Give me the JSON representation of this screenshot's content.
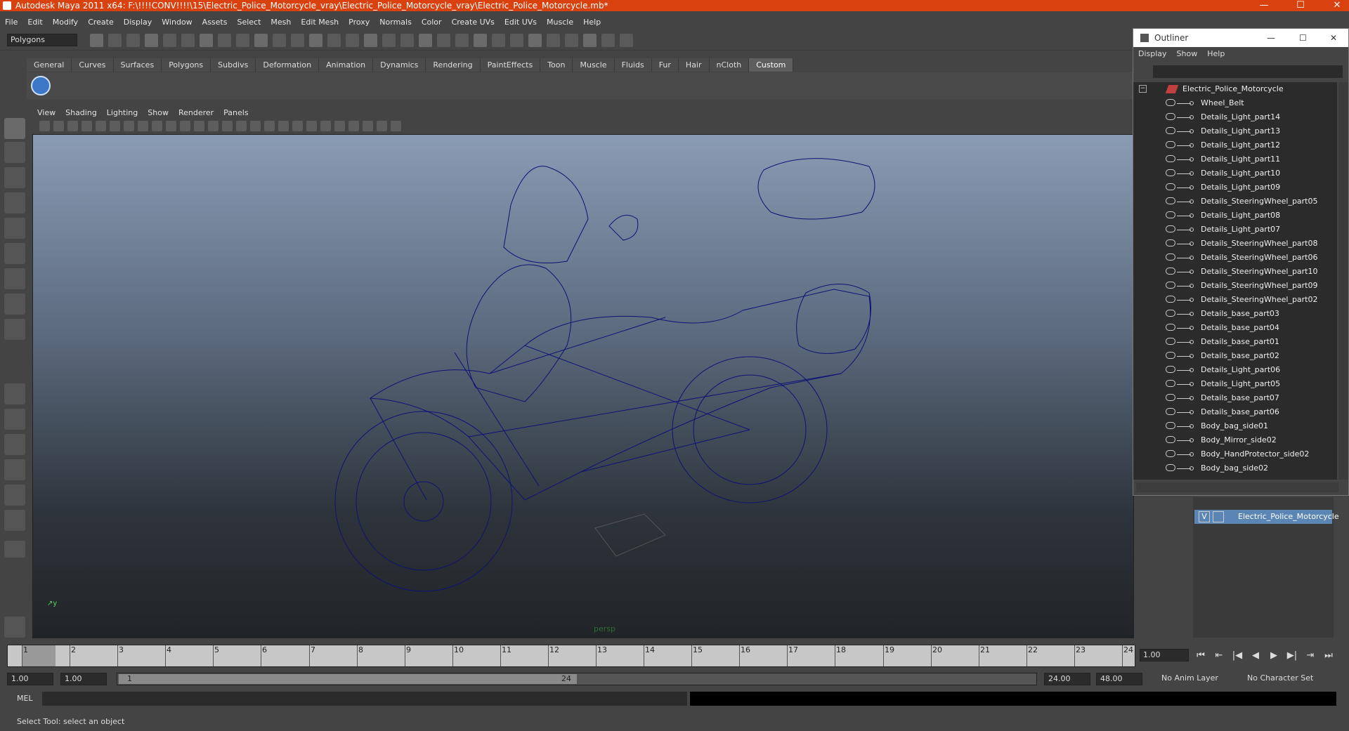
{
  "window": {
    "title": "Autodesk Maya 2011 x64: F:\\!!!!CONV!!!!\\15\\Electric_Police_Motorcycle_vray\\Electric_Police_Motorcycle_vray\\Electric_Police_Motorcycle.mb*",
    "minimize": "—",
    "maximize": "☐",
    "close": "✕"
  },
  "menubar": [
    "File",
    "Edit",
    "Modify",
    "Create",
    "Display",
    "Window",
    "Assets",
    "Select",
    "Mesh",
    "Edit Mesh",
    "Proxy",
    "Normals",
    "Color",
    "Create UVs",
    "Edit UVs",
    "Muscle",
    "Help"
  ],
  "mode_menu": "Polygons",
  "shelf_tabs": [
    "General",
    "Curves",
    "Surfaces",
    "Polygons",
    "Subdivs",
    "Deformation",
    "Animation",
    "Dynamics",
    "Rendering",
    "PaintEffects",
    "Toon",
    "Muscle",
    "Fluids",
    "Fur",
    "Hair",
    "nCloth",
    "Custom"
  ],
  "active_shelf": "Custom",
  "viewport": {
    "menus": [
      "View",
      "Shading",
      "Lighting",
      "Show",
      "Renderer",
      "Panels"
    ],
    "camera_label": "persp",
    "wire_color": "#0d1373"
  },
  "outliner": {
    "title": "Outliner",
    "menus": [
      "Display",
      "Show",
      "Help"
    ],
    "root": "Electric_Police_Motorcycle",
    "items": [
      "Wheel_Belt",
      "Details_Light_part14",
      "Details_Light_part13",
      "Details_Light_part12",
      "Details_Light_part11",
      "Details_Light_part10",
      "Details_Light_part09",
      "Details_SteeringWheel_part05",
      "Details_Light_part08",
      "Details_Light_part07",
      "Details_SteeringWheel_part08",
      "Details_SteeringWheel_part06",
      "Details_SteeringWheel_part10",
      "Details_SteeringWheel_part09",
      "Details_SteeringWheel_part02",
      "Details_base_part03",
      "Details_base_part04",
      "Details_base_part01",
      "Details_base_part02",
      "Details_Light_part06",
      "Details_Light_part05",
      "Details_base_part07",
      "Details_base_part06",
      "Body_bag_side01",
      "Body_Mirror_side02",
      "Body_HandProtector_side02",
      "Body_bag_side02"
    ]
  },
  "layer": {
    "visible": "V",
    "name": "Electric_Police_Motorcycle"
  },
  "timeline": {
    "ticks": [
      "1",
      "2",
      "3",
      "4",
      "5",
      "6",
      "7",
      "8",
      "9",
      "10",
      "11",
      "12",
      "13",
      "14",
      "15",
      "16",
      "17",
      "18",
      "19",
      "20",
      "21",
      "22",
      "23",
      "24"
    ],
    "current_frame": "1.00"
  },
  "range": {
    "start": "1.00",
    "anim_start": "1.00",
    "slider_start": "1",
    "slider_end": "24",
    "anim_end": "24.00",
    "end": "48.00",
    "anim_layer": "No Anim Layer",
    "character_set": "No Character Set"
  },
  "mel_label": "MEL",
  "help_line": "Select Tool: select an object",
  "playback_controls": [
    "⏮",
    "⇤",
    "|◀",
    "◀",
    "▶",
    "▶|",
    "⇥",
    "⏭"
  ]
}
